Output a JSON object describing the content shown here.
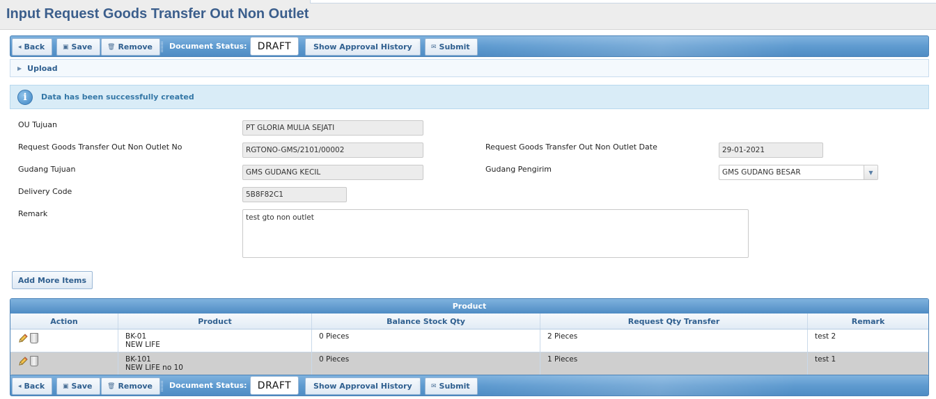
{
  "page": {
    "title": "Input Request Goods Transfer Out Non Outlet"
  },
  "toolbar": {
    "back_label": "Back",
    "save_label": "Save",
    "remove_label": "Remove",
    "status_label": "Document Status:",
    "status_value": "DRAFT",
    "approval_label": "Show Approval History",
    "submit_label": "Submit"
  },
  "upload": {
    "label": "Upload"
  },
  "message": {
    "text": "Data has been successfully created"
  },
  "form": {
    "ou_tujuan": {
      "label": "OU Tujuan",
      "value": "PT GLORIA MULIA SEJATI"
    },
    "request_no": {
      "label": "Request Goods Transfer Out Non Outlet No",
      "value": "RGTONO-GMS/2101/00002"
    },
    "request_date": {
      "label": "Request Goods Transfer Out Non Outlet Date",
      "value": "29-01-2021"
    },
    "gudang_tujuan": {
      "label": "Gudang Tujuan",
      "value": "GMS GUDANG KECIL"
    },
    "gudang_pengirim": {
      "label": "Gudang Pengirim",
      "value": "GMS GUDANG BESAR"
    },
    "delivery_code": {
      "label": "Delivery Code",
      "value": "5B8F82C1"
    },
    "remark": {
      "label": "Remark",
      "value": "test gto non outlet"
    }
  },
  "add_items": {
    "label": "Add More Items"
  },
  "grid": {
    "title": "Product",
    "columns": [
      "Action",
      "Product",
      "Balance Stock Qty",
      "Request Qty Transfer",
      "Remark"
    ],
    "rows": [
      {
        "code": "BK-01",
        "name": "NEW LIFE",
        "balance": "0 Pieces",
        "request": "2 Pieces",
        "remark": "test 2"
      },
      {
        "code": "BK-101",
        "name": "NEW LIFE no 10",
        "balance": "0 Pieces",
        "request": "1 Pieces",
        "remark": "test 1"
      }
    ]
  },
  "colors": {
    "accent": "#5f9bd0",
    "title": "#3b5e8c",
    "button_text": "#2f5f8f",
    "info_bg": "#d9ecf7"
  }
}
